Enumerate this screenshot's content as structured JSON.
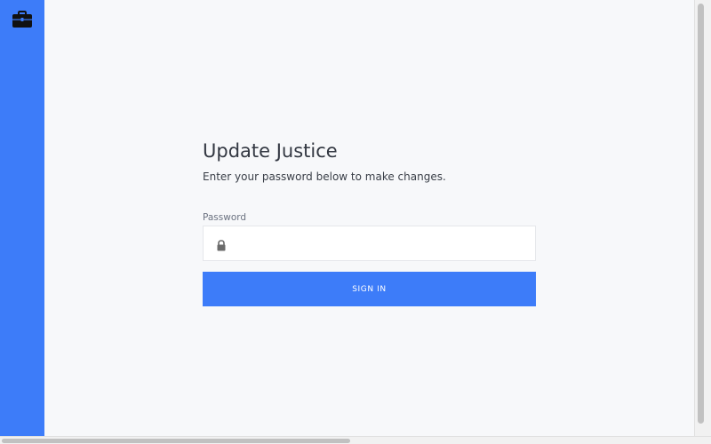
{
  "sidebar": {
    "logo_icon": "briefcase-icon",
    "background": "#3d7cf9"
  },
  "form": {
    "title": "Update Justice",
    "subtitle": "Enter your password below to make changes.",
    "password_label": "Password",
    "password_value": "",
    "password_icon": "lock-icon",
    "submit_label": "SIGN IN"
  },
  "colors": {
    "accent": "#3d7cf9",
    "page_background": "#f7f8fa"
  }
}
